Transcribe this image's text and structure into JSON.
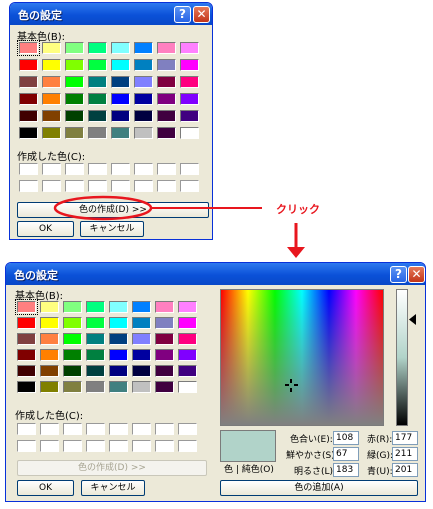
{
  "dialog1": {
    "title": "色の設定",
    "help_label": "?",
    "close_label": "✕",
    "basic_label": "基本色(B):",
    "custom_label": "作成した色(C):",
    "define_button": "色の作成(D) >>",
    "ok_button": "OK",
    "cancel_button": "キャンセル"
  },
  "annotation": {
    "click_label": "クリック",
    "ellipse_color": "#e8161e",
    "arrow_color": "#e8161e"
  },
  "dialog2": {
    "title": "色の設定",
    "help_label": "?",
    "close_label": "✕",
    "basic_label": "基本色(B):",
    "custom_label": "作成した色(C):",
    "define_button": "色の作成(D) >>",
    "ok_button": "OK",
    "cancel_button": "キャンセル",
    "color_solid_label": "色 | 純色(O)",
    "add_button": "色の追加(A)",
    "hue_label": "色合い(E):",
    "sat_label": "鮮やかさ(S):",
    "lum_label": "明るさ(L):",
    "red_label": "赤(R):",
    "green_label": "緑(G):",
    "blue_label": "青(U):",
    "hue_value": "108",
    "sat_value": "67",
    "lum_value": "183",
    "red_value": "177",
    "green_value": "211",
    "blue_value": "201",
    "preview_color": "#b1d3c9"
  },
  "basic_colors": [
    [
      "#ff8080",
      "#ffff80",
      "#80ff80",
      "#00ff80",
      "#80ffff",
      "#0080ff",
      "#ff80c0",
      "#ff80ff"
    ],
    [
      "#ff0000",
      "#ffff00",
      "#80ff00",
      "#00ff40",
      "#00ffff",
      "#0080c0",
      "#8080c0",
      "#ff00ff"
    ],
    [
      "#804040",
      "#ff8040",
      "#00ff00",
      "#008080",
      "#004080",
      "#8080ff",
      "#800040",
      "#ff0080"
    ],
    [
      "#800000",
      "#ff8000",
      "#008000",
      "#008040",
      "#0000ff",
      "#0000a0",
      "#800080",
      "#8000ff"
    ],
    [
      "#400000",
      "#804000",
      "#004000",
      "#004040",
      "#000080",
      "#000040",
      "#400040",
      "#400080"
    ],
    [
      "#000000",
      "#808000",
      "#808040",
      "#808080",
      "#408080",
      "#c0c0c0",
      "#400040",
      "#ffffff"
    ]
  ]
}
